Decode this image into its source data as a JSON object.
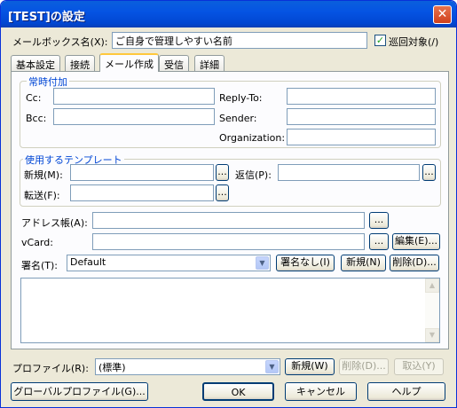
{
  "window": {
    "title": "[TEST]の設定",
    "close": "✕"
  },
  "mailbox": {
    "label": "メールボックス名(X):",
    "value": "ご自身で管理しやすい名前",
    "patrol_label": "巡回対象(/)",
    "patrol_checked": "✓"
  },
  "tabs": [
    "基本設定",
    "接続",
    "メール作成",
    "受信",
    "詳細"
  ],
  "header_group": {
    "title": "常時付加",
    "cc": "Cc:",
    "bcc": "Bcc:",
    "reply_to": "Reply-To:",
    "sender": "Sender:",
    "organization": "Organization:"
  },
  "template_group": {
    "title": "使用するテンプレート",
    "new": "新規(M):",
    "reply": "返信(P):",
    "forward": "転送(F):",
    "browse": "..."
  },
  "address": {
    "label": "アドレス帳(A):",
    "browse": "..."
  },
  "vcard": {
    "label": "vCard:",
    "browse": "...",
    "edit": "編集(E)..."
  },
  "signature": {
    "label": "署名(T):",
    "selected": "Default",
    "none_btn": "署名なし(I)",
    "new_btn": "新規(N)",
    "delete_btn": "削除(D)...",
    "dd": "▼"
  },
  "scroll": {
    "up": "▲",
    "down": "▼"
  },
  "profile": {
    "label": "プロファイル(R):",
    "selected": "(標準)",
    "new_btn": "新規(W)",
    "delete_btn": "削除(D)...",
    "cancel_btn": "取込(Y)"
  },
  "footer": {
    "global_btn": "グローバルプロファイル(G)...",
    "ok": "OK",
    "cancel": "キャンセル",
    "help": "ヘルプ"
  }
}
